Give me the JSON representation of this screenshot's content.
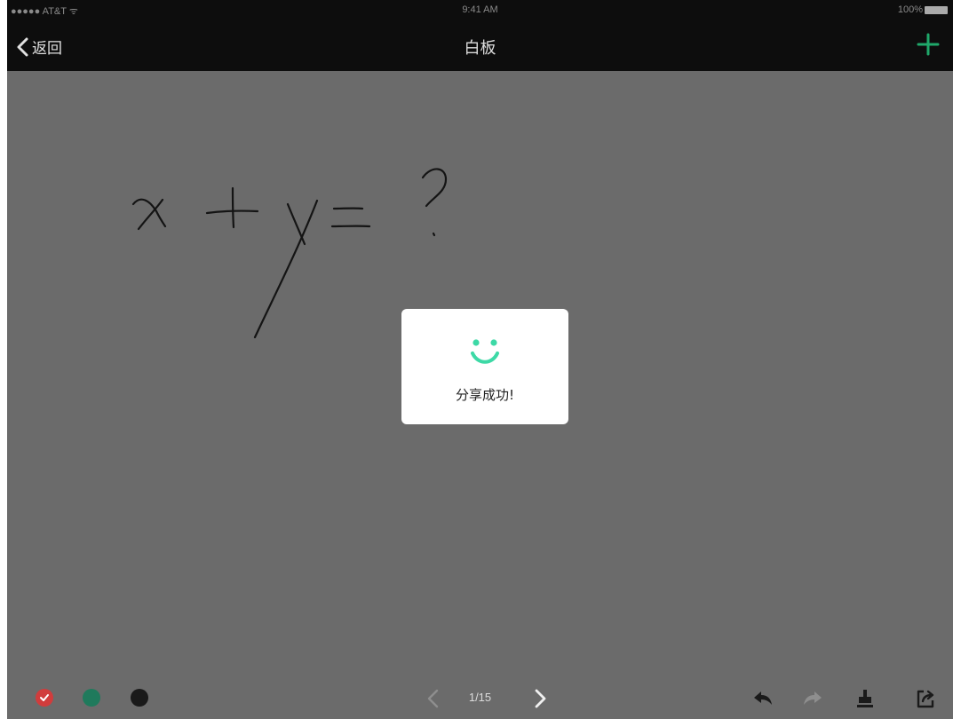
{
  "status_bar": {
    "carrier": "●●●●● AT&T ᯤ",
    "time": "9:41 AM",
    "battery": "100%"
  },
  "nav": {
    "back_label": "返回",
    "title": "白板",
    "add_icon": "plus-icon"
  },
  "whiteboard": {
    "handwriting": "x + y = ?"
  },
  "toast": {
    "message": "分享成功!",
    "icon": "smiley-icon",
    "accent": "#3dd9a6"
  },
  "toolbar": {
    "colors": [
      {
        "name": "red",
        "hex": "#d13c3c",
        "selected": true
      },
      {
        "name": "green",
        "hex": "#1f7a5c",
        "selected": false
      },
      {
        "name": "black",
        "hex": "#1a1a1a",
        "selected": false
      }
    ],
    "page_indicator": "1/15",
    "icons": [
      "chevron-left-icon",
      "chevron-right-icon",
      "undo-icon",
      "redo-icon",
      "eraser-icon",
      "share-icon"
    ]
  },
  "colors": {
    "overlay": "#6b6b6b",
    "bar": "#0d0d0d",
    "accent": "#3dd9a6"
  }
}
